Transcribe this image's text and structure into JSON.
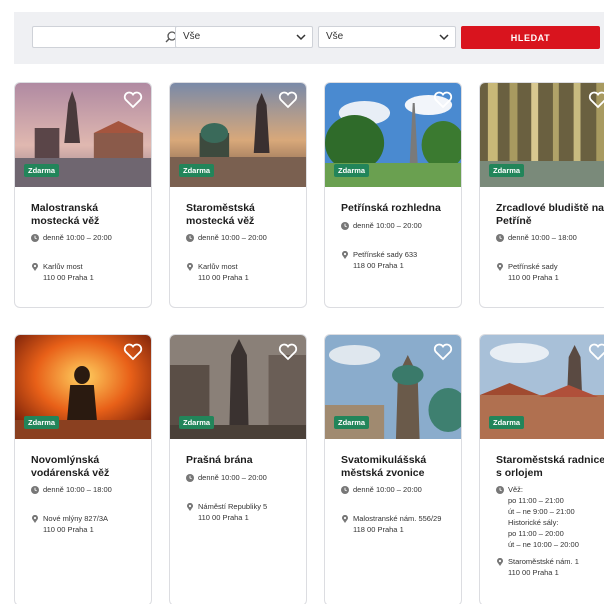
{
  "search": {
    "placeholder": "",
    "select1_value": "Vše",
    "select2_value": "Vše",
    "button_label": "HLEDAT"
  },
  "colors": {
    "accent": "#d9141e",
    "badge": "#22855a",
    "bar_bg": "#eff0f3"
  },
  "cards": [
    {
      "title_1": "Malostranská",
      "title_2": "mostecká věž",
      "badge": "Zdarma",
      "hours": "denně 10:00 – 20:00",
      "addr_1": "Karlův most",
      "addr_2": "110 00 Praha 1"
    },
    {
      "title_1": "Staroměstská",
      "title_2": "mostecká věž",
      "badge": "Zdarma",
      "hours": "denně 10:00 – 20:00",
      "addr_1": "Karlův most",
      "addr_2": "110 00 Praha 1"
    },
    {
      "title_1": "Petřínská rozhledna",
      "title_2": "",
      "badge": "Zdarma",
      "hours": "denně 10:00 – 20:00",
      "addr_1": "Petřínské sady 633",
      "addr_2": "118 00 Praha 1"
    },
    {
      "title_1": "Zrcadlové bludiště na",
      "title_2": "Petříně",
      "badge": "Zdarma",
      "hours": "denně 10:00 – 18:00",
      "addr_1": "Petřínské sady",
      "addr_2": "110 00 Praha 1"
    },
    {
      "title_1": "Novomlýnská",
      "title_2": "vodárenská věž",
      "badge": "Zdarma",
      "hours": "denně 10:00 – 18:00",
      "addr_1": "Nové mlýny 827/3A",
      "addr_2": "110 00 Praha 1"
    },
    {
      "title_1": "Prašná brána",
      "title_2": "",
      "badge": "Zdarma",
      "hours": "denně 10:00 – 20:00",
      "addr_1": "Náměstí Republiky 5",
      "addr_2": "110 00 Praha 1"
    },
    {
      "title_1": "Svatomikulášská",
      "title_2": "městská zvonice",
      "badge": "Zdarma",
      "hours": "denně 10:00 – 20:00",
      "addr_1": "Malostranské nám. 556/29",
      "addr_2": "118 00 Praha 1"
    },
    {
      "title_1": "Staroměstská radnice",
      "title_2": "s orlojem",
      "badge": "Zdarma",
      "hours": "Věž:",
      "hours_extra": [
        "po 11:00 – 21:00",
        "út – ne 9:00 – 21:00",
        "Historické sály:",
        "po 11:00 – 20:00",
        "út – ne 10:00 – 20:00"
      ],
      "addr_1": "Staroměstské nám. 1",
      "addr_2": "110 00 Praha 1"
    }
  ]
}
